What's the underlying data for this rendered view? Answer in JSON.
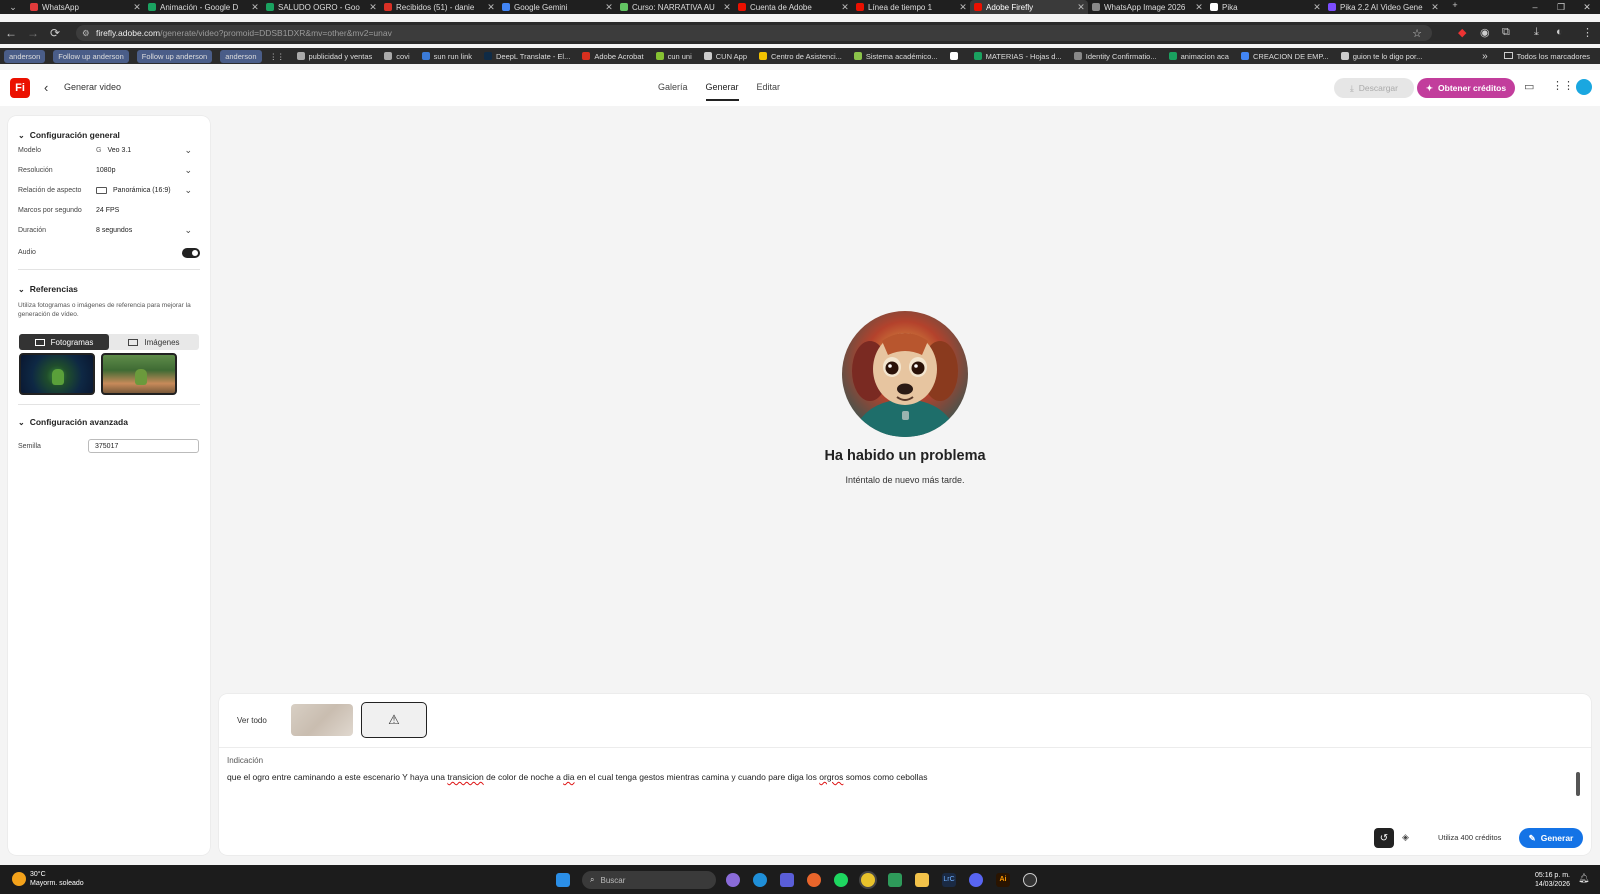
{
  "browser": {
    "tabs": [
      {
        "title": "WhatsApp",
        "color": "#e03b3b"
      },
      {
        "title": "Animación - Google D",
        "color": "#1aa260"
      },
      {
        "title": "SALUDO OGRO - Goo",
        "color": "#1aa260"
      },
      {
        "title": "Recibidos (51) - danie",
        "color": "#d93025"
      },
      {
        "title": "Google Gemini",
        "color": "#4285f4"
      },
      {
        "title": "Curso: NARRATIVA AU",
        "color": "#62c462"
      },
      {
        "title": "Cuenta de Adobe",
        "color": "#eb1000"
      },
      {
        "title": "Línea de tiempo 1",
        "color": "#eb1000"
      },
      {
        "title": "Adobe Firefly",
        "color": "#eb1000",
        "active": true
      },
      {
        "title": "WhatsApp Image 2026",
        "color": "#888888"
      },
      {
        "title": "Pika",
        "color": "#ffffff"
      },
      {
        "title": "Pika 2.2 AI Video Gene",
        "color": "#7c4dff"
      }
    ],
    "new_tab": "+",
    "url_host": "firefly.adobe.com",
    "url_path": "/generate/video?promoid=DDSB1DXR&mv=other&mv2=unav",
    "bookmarks": [
      {
        "label": "anderson",
        "pill": true
      },
      {
        "label": "Follow up anderson",
        "pill": true
      },
      {
        "label": "Follow up anderson",
        "pill": true
      },
      {
        "label": "anderson",
        "pill": true
      },
      {
        "label": "publicidad y ventas",
        "color": "#aaaaaa"
      },
      {
        "label": "covi",
        "color": "#aaaaaa"
      },
      {
        "label": "sun run link",
        "color": "#3b7bd8"
      },
      {
        "label": "DeepL Translate - El...",
        "color": "#0f2b46"
      },
      {
        "label": "Adobe Acrobat",
        "color": "#d7301f"
      },
      {
        "label": "cun uni",
        "color": "#86c232"
      },
      {
        "label": "CUN App",
        "color": "#cccccc"
      },
      {
        "label": "Centro de Asistenci...",
        "color": "#f2c200"
      },
      {
        "label": "Sistema académico...",
        "color": "#8bc34a"
      },
      {
        "label": "",
        "color": "#ffffff"
      },
      {
        "label": "MATERIAS - Hojas d...",
        "color": "#1aa260"
      },
      {
        "label": "Identity Confirmatio...",
        "color": "#888888"
      },
      {
        "label": "animacion aca",
        "color": "#1aa260"
      },
      {
        "label": "CREACION DE EMP...",
        "color": "#4285f4"
      },
      {
        "label": "guion te lo digo por...",
        "color": "#cccccc"
      }
    ],
    "bookmarks_more": "»",
    "all_bookmarks": "Todos los marcadores"
  },
  "header": {
    "logo": "Fi",
    "back_icon": "‹",
    "title": "Generar video",
    "tabs": [
      "Galería",
      "Generar",
      "Editar"
    ],
    "active_tab": "Generar",
    "download": "Descargar",
    "get_credits": "Obtener créditos"
  },
  "panel": {
    "general_title": "Configuración general",
    "fields": {
      "model_label": "Modelo",
      "model_value": "Veo 3.1",
      "model_prefix": "G",
      "resolution_label": "Resolución",
      "resolution_value": "1080p",
      "aspect_label": "Relación de aspecto",
      "aspect_value": "Panorámica (16:9)",
      "fps_label": "Marcos por segundo",
      "fps_value": "24 FPS",
      "duration_label": "Duración",
      "duration_value": "8 segundos",
      "audio_label": "Audio",
      "audio_on": true
    },
    "refs_title": "Referencias",
    "refs_desc": "Utiliza fotogramas o imágenes de referencia para mejorar la generación de vídeo.",
    "seg_frames": "Fotogramas",
    "seg_images": "Imágenes",
    "advanced_title": "Configuración avanzada",
    "seed_label": "Semilla",
    "seed_value": "375017"
  },
  "main": {
    "error_title": "Ha habido un problema",
    "error_subtitle": "Inténtalo de nuevo más tarde."
  },
  "prompt_bar": {
    "see_all": "Ver todo",
    "prompt_label": "Indicación",
    "prompt_text_parts": [
      "que el ogro entre caminando a este escenario Y haya una ",
      "transicion",
      " de color de noche a ",
      "dia",
      " en el cual tenga gestos mientras camina y  cuando pare diga los ",
      "orgros",
      " somos como cebollas"
    ],
    "credits_usage": "Utiliza 400 créditos",
    "generate": "Generar"
  },
  "taskbar": {
    "temp": "30°C",
    "weather": "Mayorm. soleado",
    "search_placeholder": "Buscar",
    "time": "05:16 p. m.",
    "date": "14/03/2026"
  }
}
